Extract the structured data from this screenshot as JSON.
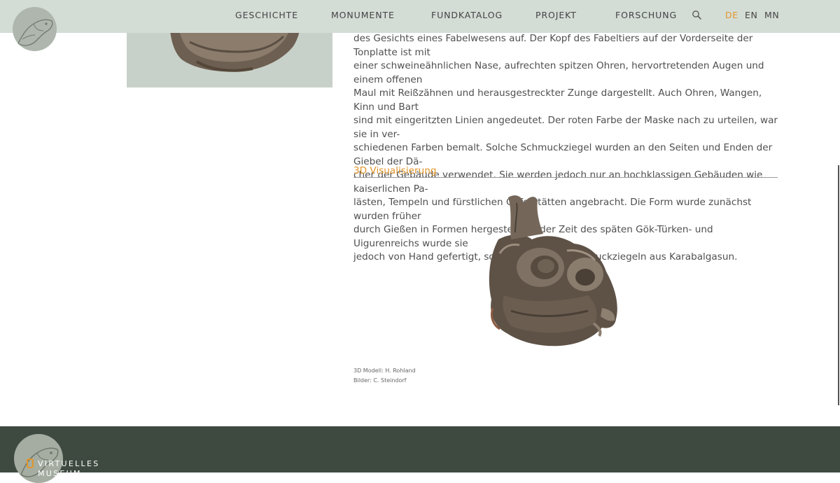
{
  "header": {
    "nav": [
      {
        "label": "GESCHICHTE"
      },
      {
        "label": "MONUMENTE"
      },
      {
        "label": "FUNDKATALOG"
      },
      {
        "label": "PROJEKT"
      },
      {
        "label": "FORSCHUNG"
      }
    ],
    "search_icon": "search-icon",
    "languages": [
      {
        "label": "DE",
        "active": true
      },
      {
        "label": "EN",
        "active": false
      },
      {
        "label": "MN",
        "active": false
      }
    ],
    "accent_color": "#e1962a",
    "bar_color": "#d4dcd6"
  },
  "article": {
    "lines": [
      "des Gesichts eines Fabelwesens auf. Der Kopf des Fabeltiers auf der Vorderseite der Tonplatte ist mit",
      "einer schweineähnlichen Nase, aufrechten spitzen Ohren, hervortretenden Augen und einem offenen",
      "Maul mit Reißzähnen und herausgestreckter Zunge dargestellt. Auch Ohren, Wangen, Kinn und Bart",
      "sind mit eingeritzten Linien angedeutet. Der roten Farbe der Maske nach zu urteilen, war sie in ver-",
      "schiedenen Farben bemalt. Solche Schmuckziegel wurden an den Seiten und Enden der Giebel der Dä-",
      "cher der Gebäude verwendet. Sie werden jedoch nur an hochklassigen Gebäuden wie kaiserlichen Pa-",
      "lästen, Tempeln und fürstlichen Opferstätten angebracht. Die Form wurde zunächst wurden früher",
      "durch Gießen in Formen hergestellt, in der Zeit des späten Gök-Türken- und Uigurenreichs wurde sie",
      "jedoch von Hand gefertigt, so wie bei diesen Schmuckziegeln aus Karabalgasun."
    ],
    "section_title": "3D Visualisierung",
    "credits": {
      "model": "3D Modell: H. Rohland",
      "images": "Bilder: C. Steindorf"
    }
  },
  "footer": {
    "brand_line1": "VIRTUELLES",
    "brand_line2": "MUSEUM",
    "bg_color": "#3e4a40"
  }
}
